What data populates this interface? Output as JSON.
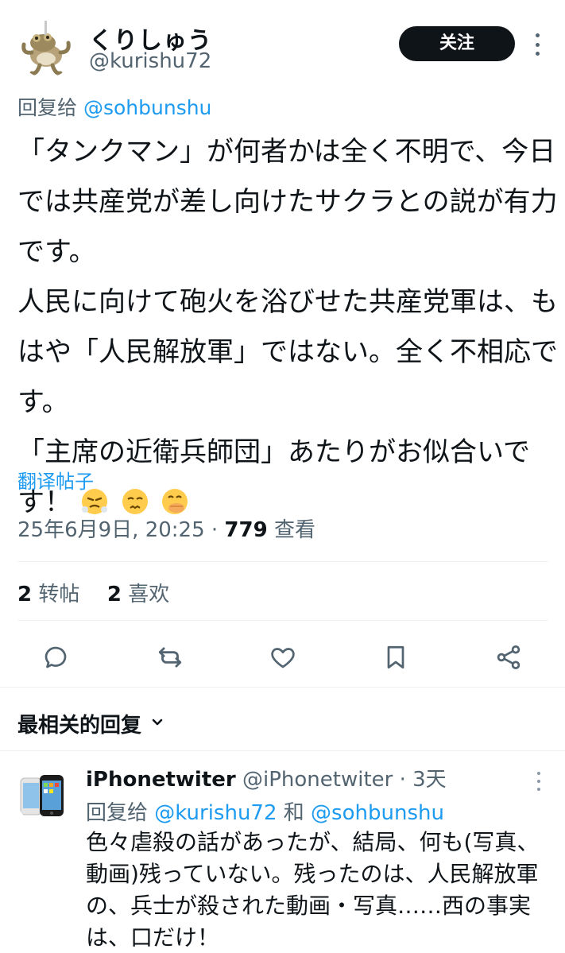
{
  "post": {
    "author": {
      "display_name": "くりしゅう",
      "handle": "@kurishu72",
      "avatar_icon": "frog-avatar"
    },
    "follow_label": "关注",
    "reply_to": {
      "prefix": "回复给",
      "target": "@sohbunshu"
    },
    "text_lines": [
      "「タンクマン」が何者かは全く不明で、今日",
      "では共産党が差し向けたサクラとの説が有力",
      "です。",
      "人民に向けて砲火を浴びせた共産党軍は、も",
      "はや「人民解放軍」ではない。全く不相応で",
      "す。",
      "「主席の近衛兵師団」あたりがお似合いで",
      "す！"
    ],
    "emojis": [
      "steam-from-nose-emoji",
      "persevering-face-emoji",
      "hand-over-mouth-emoji"
    ],
    "translate_label": "翻译帖子",
    "timestamp": "25年6月9日, 20:25 · ",
    "views_count": "779",
    "views_label": " 查看",
    "reposts_count": "2",
    "reposts_label": "转帖",
    "likes_count": "2",
    "likes_label": "喜欢"
  },
  "actions": [
    "reply-icon",
    "repost-icon",
    "like-icon",
    "bookmark-icon",
    "share-icon"
  ],
  "replies_sort_label": "最相关的回复",
  "replies": [
    {
      "display_name": "iPhonetwiter",
      "handle_time": " @iPhonetwiter · 3天",
      "reply_prefix": "回复给 ",
      "reply_target_1": "@kurishu72",
      "reply_and": " 和 ",
      "reply_target_2": "@sohbunshu",
      "text_lines": [
        "色々虐殺の話があったが、結局、何も(写真、",
        "動画)残っていない。残ったのは、人民解放軍",
        "の、兵士が殺された動画・写真……西の事実",
        "は、口だけ！"
      ],
      "avatar_icon": "iphone-avatar"
    }
  ],
  "colors": {
    "accent": "#1d9bf0",
    "text": "#0f1419",
    "secondary": "#536471",
    "divider": "#eff3f4"
  }
}
